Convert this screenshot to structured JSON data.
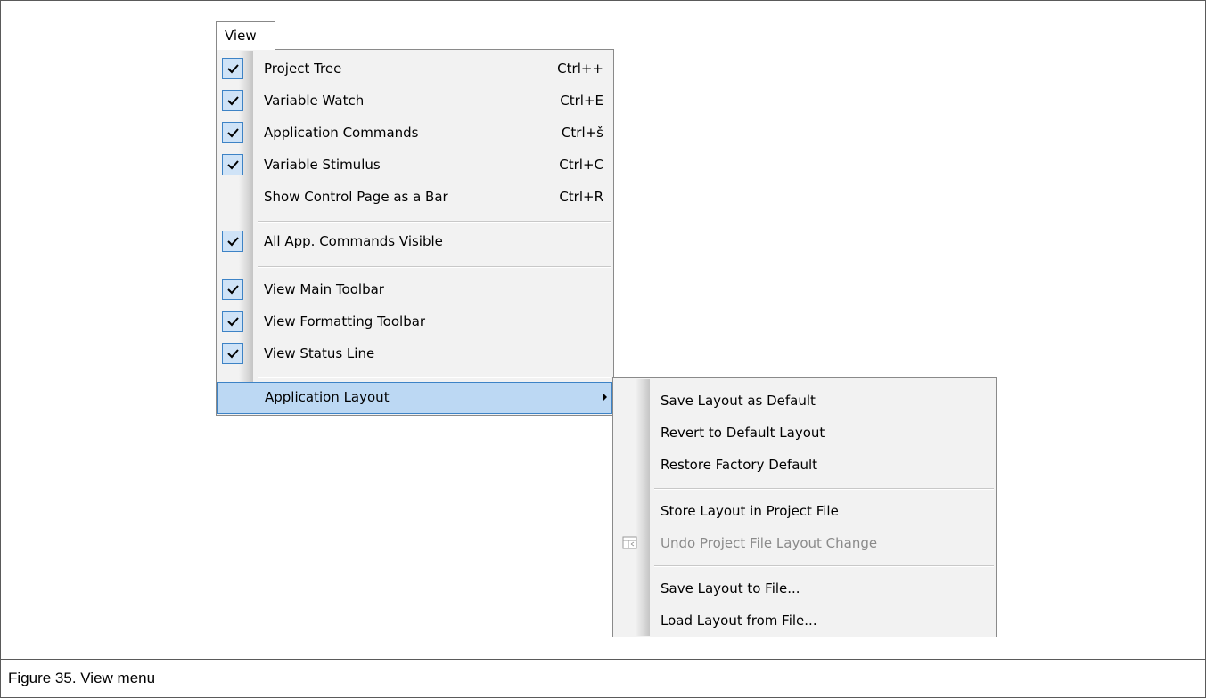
{
  "view_tab_label": "View",
  "main_menu": {
    "items": [
      {
        "label": "Project Tree",
        "shortcut": "Ctrl++",
        "checked": true
      },
      {
        "label": "Variable Watch",
        "shortcut": "Ctrl+E",
        "checked": true
      },
      {
        "label": "Application Commands",
        "shortcut": "Ctrl+š",
        "checked": true
      },
      {
        "label": "Variable Stimulus",
        "shortcut": "Ctrl+C",
        "checked": true
      },
      {
        "label": "Show Control Page as a Bar",
        "shortcut": "Ctrl+R",
        "checked": false
      },
      {
        "label": "All App. Commands Visible",
        "shortcut": "",
        "checked": true
      },
      {
        "label": "View Main Toolbar",
        "shortcut": "",
        "checked": true
      },
      {
        "label": "View Formatting Toolbar",
        "shortcut": "",
        "checked": true
      },
      {
        "label": "View Status Line",
        "shortcut": "",
        "checked": true
      },
      {
        "label": "Application Layout",
        "shortcut": "",
        "checked": false,
        "submenu": true
      }
    ]
  },
  "sub_menu": {
    "items": [
      {
        "label": "Save Layout as Default",
        "disabled": false
      },
      {
        "label": "Revert to Default Layout",
        "disabled": false
      },
      {
        "label": "Restore Factory Default",
        "disabled": false
      },
      {
        "label": "Store Layout in Project File",
        "disabled": false
      },
      {
        "label": "Undo Project File Layout Change",
        "disabled": true,
        "icon": "layout-undo-icon"
      },
      {
        "label": "Save Layout to File...",
        "disabled": false
      },
      {
        "label": "Load Layout from File...",
        "disabled": false
      }
    ]
  },
  "caption": "Figure 35.  View menu",
  "colors": {
    "highlight": "#bcd8f3",
    "highlight_border": "#3d83c6",
    "check_bg": "#cfe3f7",
    "menu_bg": "#f2f2f2",
    "disabled_text": "#8a8a8a"
  }
}
